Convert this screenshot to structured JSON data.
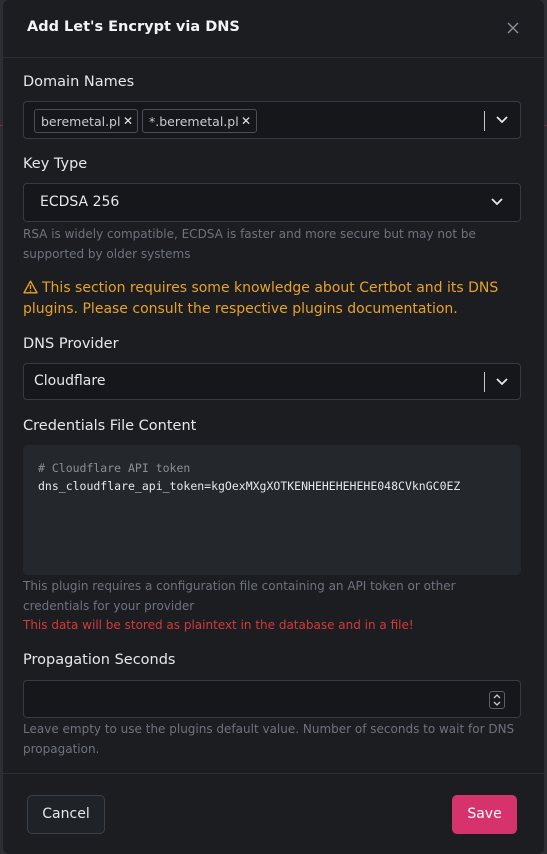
{
  "modal": {
    "title": "Add Let's Encrypt via DNS"
  },
  "domain_names": {
    "label": "Domain Names",
    "chips": [
      "beremetal.pl",
      "*.beremetal.pl"
    ]
  },
  "key_type": {
    "label": "Key Type",
    "value": "ECDSA 256",
    "help": "RSA is widely compatible, ECDSA is faster and more secure but may not be supported by older systems"
  },
  "warning": {
    "icon": "warning-triangle-icon",
    "text": "This section requires some knowledge about Certbot and its DNS plugins. Please consult the respective plugins documentation."
  },
  "dns_provider": {
    "label": "DNS Provider",
    "value": "Cloudflare"
  },
  "credentials": {
    "label": "Credentials File Content",
    "line1": "# Cloudflare API token",
    "line2": "dns_cloudflare_api_token=kgOexMXgXOTKENHEHEHEHEHE048CVknGC0EZ",
    "help": "This plugin requires a configuration file containing an API token or other credentials for your provider",
    "danger": "This data will be stored as plaintext in the database and in a file!"
  },
  "propagation": {
    "label": "Propagation Seconds",
    "value": "",
    "help": "Leave empty to use the plugins default value. Number of seconds to wait for DNS propagation."
  },
  "footer": {
    "cancel_label": "Cancel",
    "save_label": "Save"
  },
  "colors": {
    "accent": "#d6336c",
    "warning": "#e8a227",
    "danger": "#d63939"
  }
}
